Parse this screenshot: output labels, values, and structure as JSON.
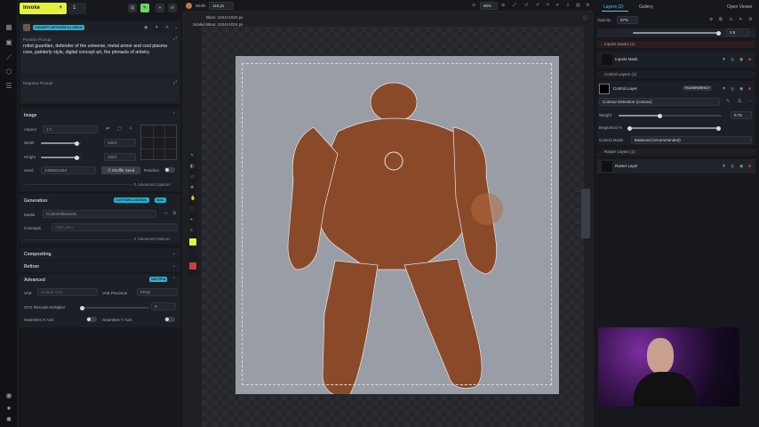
{
  "toolbar": {
    "invoke_label": "Invoke",
    "plus": "+",
    "queue_count": "1"
  },
  "prompt": {
    "model_tag": "CONCEPT ARTWORK ILLUSION",
    "positive_title": "Positive Prompt",
    "positive_text": "robot guardian, defender of the universe, metal armor and cool plasma core, painterly style, digital concept art, the pinnacle of artistry.",
    "negative_title": "Negative Prompt"
  },
  "image": {
    "title": "Image",
    "aspect_label": "Aspect",
    "aspect_value": "1:1",
    "width_label": "Width",
    "width_value": "1024",
    "height_label": "Height",
    "height_value": "1024",
    "seed_label": "Seed",
    "seed_value": "1495301454",
    "shuffle_label": "Shuffle Seed",
    "random_label": "Random",
    "advanced_label": "Advanced Options"
  },
  "generation": {
    "title": "Generation",
    "tag_model": "CUSTOMILLUSIONXL",
    "tag_sdxl": "SDXL",
    "model_label": "Model",
    "model_value": "CustomIllusionXL",
    "concepts_label": "Concepts",
    "concepts_placeholder": "Add LoRA",
    "advanced_label": "Advanced Options"
  },
  "compositing": {
    "title": "Compositing"
  },
  "refiner": {
    "title": "Refiner"
  },
  "advanced": {
    "title": "Advanced",
    "tag": "VAE FP16",
    "vae_label": "VAE",
    "vae_value": "Default VAE",
    "vae_precision_label": "VAE Precision",
    "vae_precision_value": "FP16",
    "cfg_label": "CFG Rescale Multiplier",
    "cfg_value": "0",
    "seamless_x": "Seamless X Axis",
    "seamless_y": "Seamless Y Axis"
  },
  "topbar": {
    "width_label": "Width",
    "width_value": "116 px",
    "zoom": "90%"
  },
  "canvas": {
    "bbox_label": "Bbox: 1024×1024 px",
    "scaled_label": "Scaled Bbox: 1024×1024 px"
  },
  "right": {
    "tab_layers": "Layers (2)",
    "tab_gallery": "Gallery",
    "open_viewer": "Open Viewer",
    "opacity_label": "Opacity",
    "opacity_value": "57%",
    "slider_value": "0.8",
    "inpaint_group": "Inpaint Masks (1)",
    "inpaint_mask": "Inpaint Mask",
    "control_group": "Control Layers (1)",
    "control_layer": "Control Layer",
    "transparency": "TRANSPARENCY",
    "contour": "Contour Detection (contour)",
    "weight_label": "Weight",
    "weight_value": "0.75",
    "begin_end_label": "Begin/End %",
    "control_mode_label": "Control Mode",
    "control_mode_value": "Balanced (recommended)",
    "raster_group": "Raster Layers (1)",
    "raster_layer": "Raster Layer"
  },
  "colors": {
    "accent": "#e6f33d",
    "tag_cyan": "#27b4d6",
    "robot": "#8a4a2a"
  }
}
